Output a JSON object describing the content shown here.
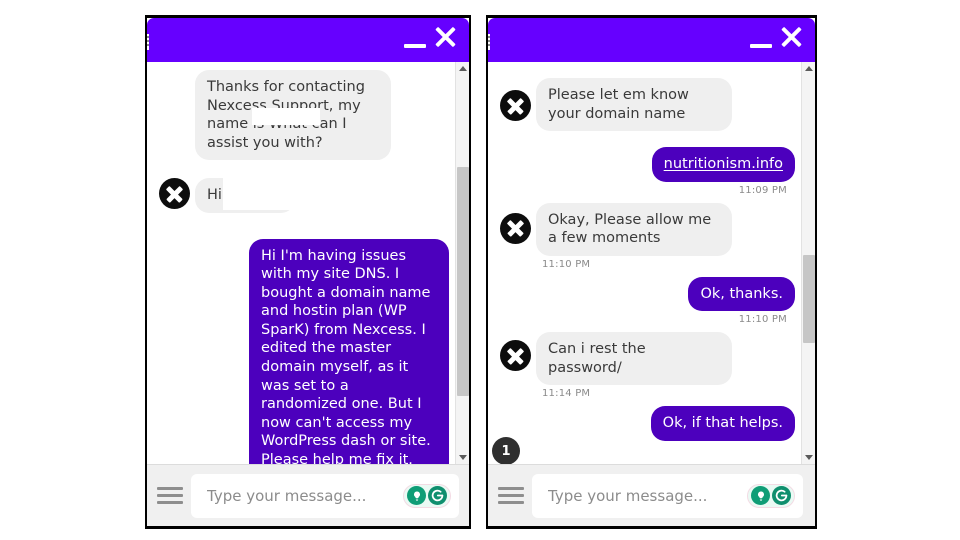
{
  "window": {
    "accent_color": "#6600ff",
    "bubble_out_color": "#4c00bd",
    "bubble_in_color": "#efefef",
    "minimize_label": "Minimize",
    "close_label": "Close"
  },
  "composer": {
    "placeholder": "Type your message...",
    "value": "",
    "menu_label": "Menu",
    "bulb_icon": "lightbulb-icon",
    "g_icon": "gorgias-g-icon"
  },
  "panels": [
    {
      "id": "left",
      "messages": [
        {
          "dir": "in",
          "show_avatar": false,
          "text": "Thanks for contacting Nexcess Support, my name is        What can I assist you with?",
          "time": ""
        },
        {
          "dir": "in",
          "show_avatar": true,
          "text": "Hi",
          "time": ""
        },
        {
          "dir": "out",
          "show_avatar": false,
          "text": "Hi         I'm having issues with my site DNS. I bought a domain name and hostin plan (WP SparK) from Nexcess. I edited the master domain myself, as it was set to a randomized one. But I now can't access my WordPress dash or site. Please help me fix it.",
          "time": ""
        }
      ],
      "scrollbar": {
        "thumb_top_pct": 26,
        "thumb_height_pct": 57
      }
    },
    {
      "id": "right",
      "messages": [
        {
          "dir": "in",
          "show_avatar": true,
          "text": "Please let em know your domain name",
          "time": ""
        },
        {
          "dir": "out",
          "show_avatar": false,
          "text": "nutritionism.info",
          "is_link": true,
          "time": "11:09 PM"
        },
        {
          "dir": "in",
          "show_avatar": true,
          "text": "Okay, Please allow me a few moments",
          "time": "11:10 PM"
        },
        {
          "dir": "out",
          "show_avatar": false,
          "text": "Ok, thanks.",
          "time": "11:10 PM"
        },
        {
          "dir": "in",
          "show_avatar": true,
          "text": "Can i rest the password/",
          "time": "11:14 PM"
        },
        {
          "dir": "out",
          "show_avatar": false,
          "text": "Ok, if that helps.",
          "time": ""
        }
      ],
      "unread_badge": "1",
      "scrollbar": {
        "thumb_top_pct": 48,
        "thumb_height_pct": 22
      }
    }
  ]
}
